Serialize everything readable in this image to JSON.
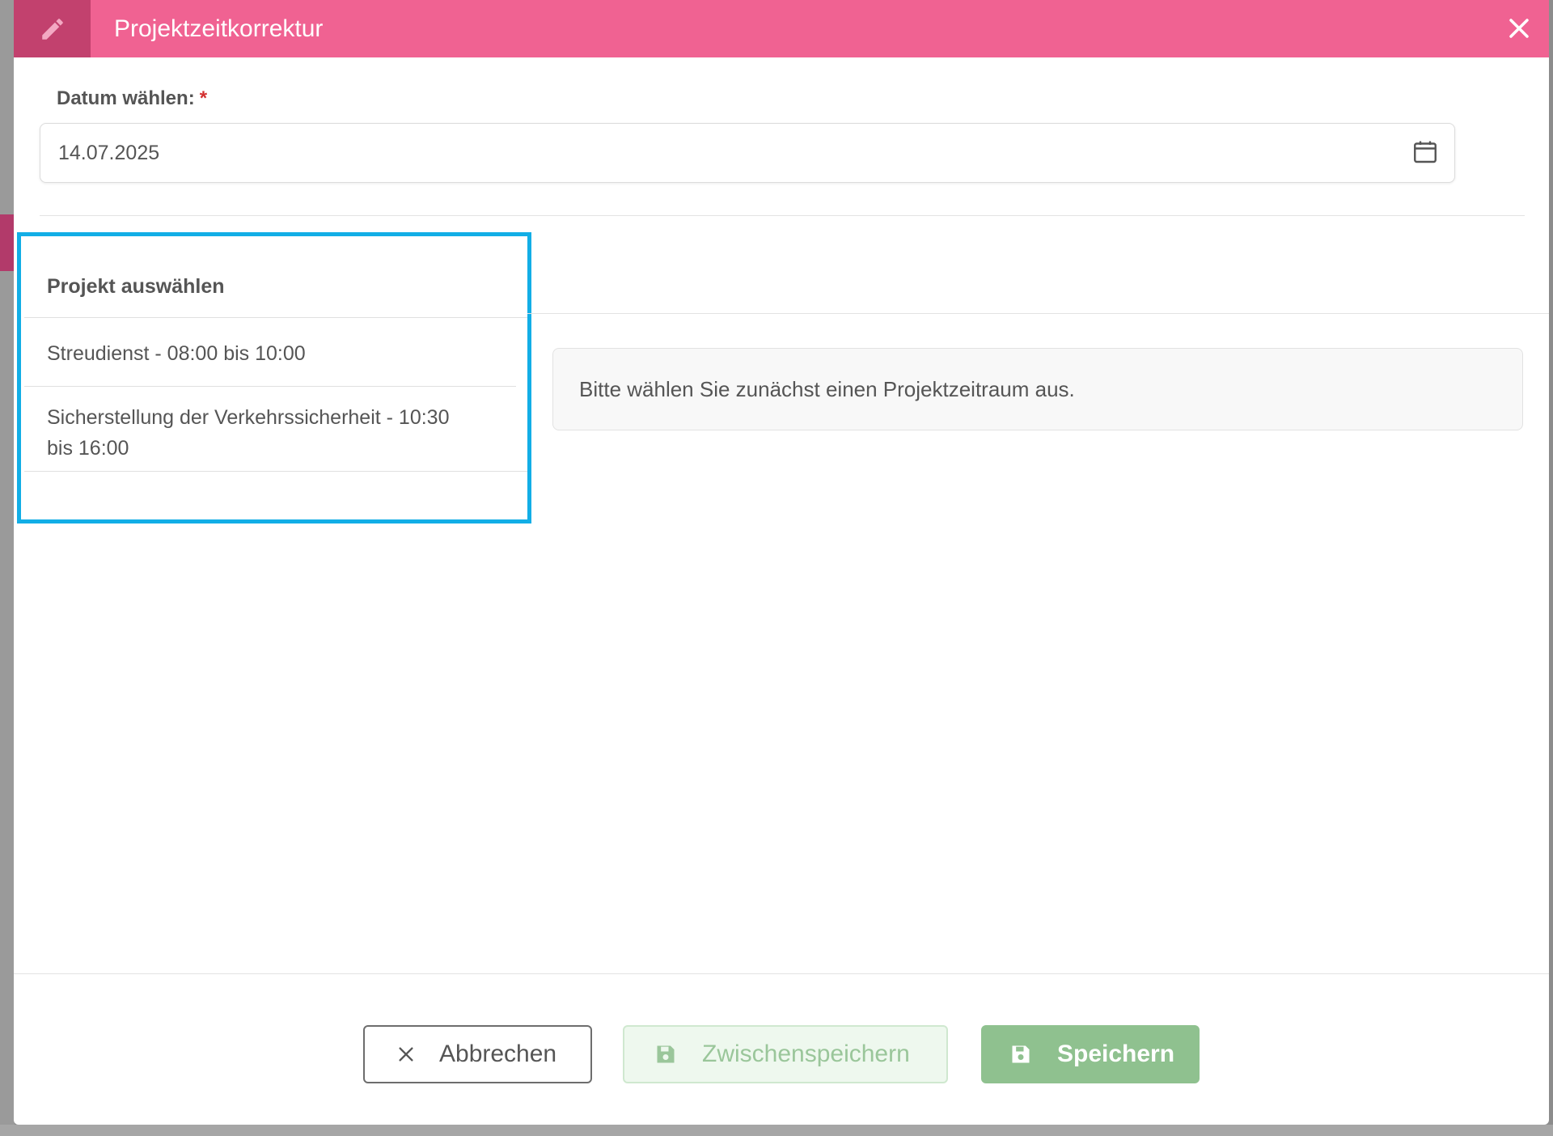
{
  "dialog": {
    "title": "Projektzeitkorrektur",
    "header_color": "#f06292",
    "header_icon": "pencil-icon",
    "close_icon": "close-icon"
  },
  "date_field": {
    "label": "Datum wählen:",
    "required_marker": "*",
    "value": "14.07.2025",
    "icon": "calendar-icon"
  },
  "project_panel": {
    "heading": "Projekt auswählen",
    "highlight_color": "#12aee6",
    "items": [
      {
        "label": "Streudienst - 08:00 bis 10:00"
      },
      {
        "label": "Sicherstellung der Verkehrssicherheit - 10:30 bis 16:00"
      }
    ]
  },
  "info": {
    "message": "Bitte wählen Sie zunächst einen Projektzeitraum aus."
  },
  "footer": {
    "cancel_label": "Abbrechen",
    "cancel_icon": "close-icon",
    "draft_label": "Zwischenspeichern",
    "draft_icon": "save-icon",
    "save_label": "Speichern",
    "save_icon": "save-icon",
    "save_color": "#8fc18f"
  }
}
